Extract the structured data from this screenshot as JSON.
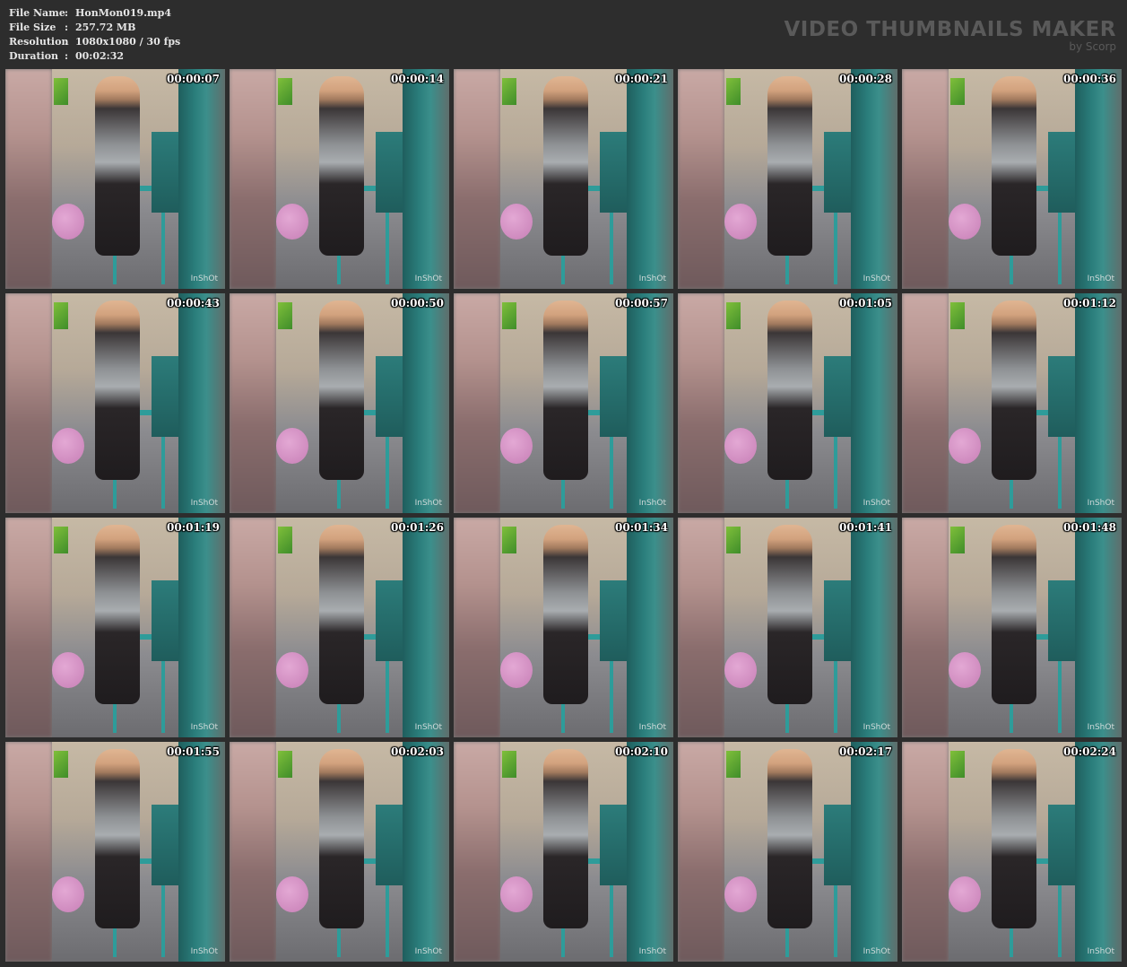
{
  "meta": [
    {
      "key": "File Name",
      "sep": ":",
      "value": "HonMon019.mp4"
    },
    {
      "key": "File Size",
      "sep": ":",
      "value": "257.72 MB"
    },
    {
      "key": "Resolution",
      "sep": ":",
      "value": "1080x1080 / 30 fps"
    },
    {
      "key": "Duration",
      "sep": ":",
      "value": "00:02:32"
    }
  ],
  "brand": {
    "title": "VIDEO THUMBNAILS MAKER",
    "subtitle": "by Scorp"
  },
  "watermark": "InShOt",
  "thumbnails": [
    "00:00:07",
    "00:00:14",
    "00:00:21",
    "00:00:28",
    "00:00:36",
    "00:00:43",
    "00:00:50",
    "00:00:57",
    "00:01:05",
    "00:01:12",
    "00:01:19",
    "00:01:26",
    "00:01:34",
    "00:01:41",
    "00:01:48",
    "00:01:55",
    "00:02:03",
    "00:02:10",
    "00:02:17",
    "00:02:24"
  ]
}
